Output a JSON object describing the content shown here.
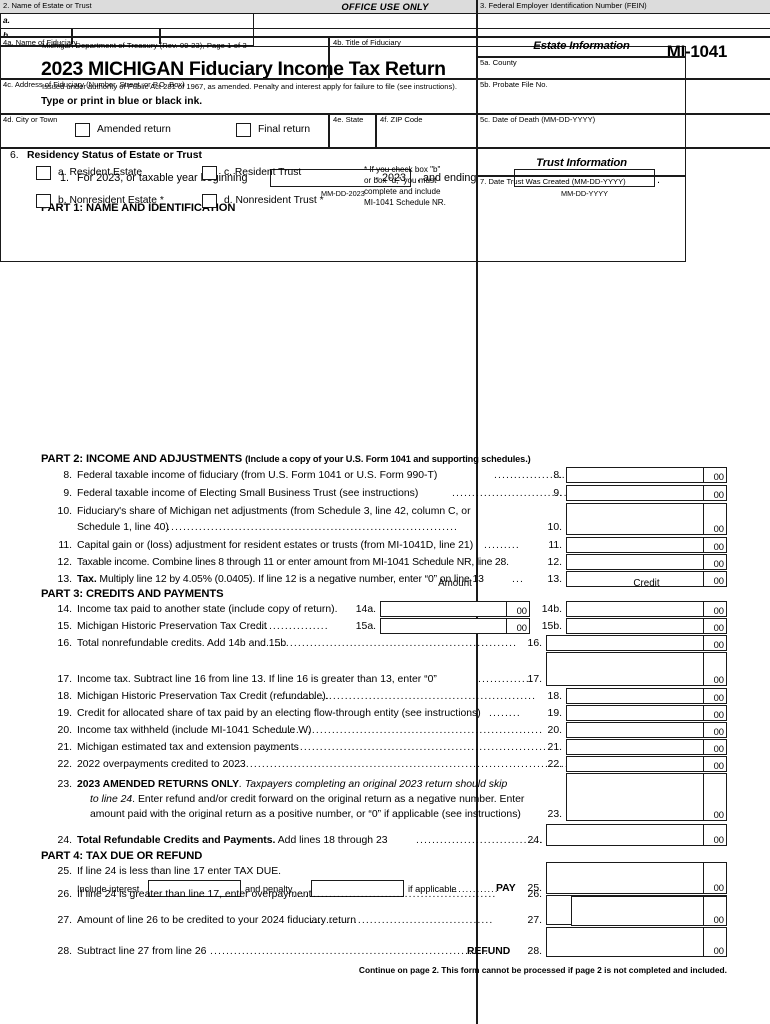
{
  "header": {
    "department": "Michigan Department of Treasury (Rev. 09-23), Page 1 of 3",
    "form_number": "MI-1041",
    "title": "2023 MICHIGAN Fiduciary Income Tax Return",
    "issued": "Issued under authority of Public Act 281 of 1967, as amended.  Penalty and interest apply for failure to file (see instructions).",
    "type_print": "Type or print in blue or black ink.",
    "amended_return": "Amended return",
    "final_return": "Final return"
  },
  "office_use": {
    "heading": "OFFICE USE ONLY",
    "row_a": "a.",
    "row_b": "b."
  },
  "line1": {
    "number": "1.",
    "text_before": "For 2023, or taxable year beginning",
    "year_suffix": "- 2023",
    "caption_begin": "MM-DD-2023",
    "text_middle": ", and ending",
    "caption_end": "MM-DD-YYYY",
    "period": "."
  },
  "part1": {
    "heading": "PART 1:  NAME AND IDENTIFICATION",
    "name_of_estate": "2. Name of Estate or Trust",
    "fein": "3. Federal Employer Identification Number (FEIN)",
    "name_of_fiduciary": "4a. Name of Fiduciary",
    "title_of_fiduciary": "4b. Title of Fiduciary",
    "estate_information": "Estate Information",
    "county": "5a. County",
    "address": "4c. Address of Fiduciary (Number, Street, or P.O. Box)",
    "probate_file": "5b. Probate File No.",
    "city": "4d. City or Town",
    "state": "4e. State",
    "zip": "4f. ZIP Code",
    "date_of_death": "5c. Date of Death (MM-DD-YYYY)",
    "residency_number": "6.",
    "residency_title": "Residency Status of Estate or Trust",
    "opt_a": "a.  Resident Estate",
    "opt_b": "b.  Nonresident Estate *",
    "opt_c": "c.  Resident Trust",
    "opt_d": "d.  Nonresident Trust *",
    "footnote_1": "* If you check box \"b\"",
    "footnote_2": "or box \"d,\" you must",
    "footnote_3": "complete and include",
    "footnote_4": "MI-1041 Schedule NR.",
    "trust_information": "Trust Information",
    "date_trust_created": "7.  Date Trust Was Created (MM-DD-YYYY)"
  },
  "part2": {
    "heading_bold": "PART 2:  INCOME AND ADJUSTMENTS",
    "heading_paren": "(Include a copy of your U.S. Form 1041 and supporting schedules.)",
    "lines": [
      {
        "num": "8.",
        "box_num": "8.",
        "text": "Federal taxable income of fiduciary (from U.S. Form 1041 or U.S. Form 990-T)",
        "cents": "00"
      },
      {
        "num": "9.",
        "box_num": "9.",
        "text": "Federal taxable income of Electing Small Business Trust (see instructions)",
        "cents": "00"
      },
      {
        "num": "10.",
        "box_num": "10.",
        "text": "Fiduciary's share of Michigan net adjustments (from Schedule 3, line 42, column C, or",
        "text2": "Schedule 1, line 40)",
        "cents": "00"
      },
      {
        "num": "11.",
        "box_num": "11.",
        "text": "Capital gain or (loss) adjustment for resident estates or trusts (from MI-1041D, line 21)",
        "cents": "00"
      },
      {
        "num": "12.",
        "box_num": "12.",
        "text": "Taxable income. Combine lines 8 through 11 or enter amount from MI-1041 Schedule NR, line 28.",
        "cents": "00"
      },
      {
        "num": "13.",
        "box_num": "13.",
        "text_bold": "Tax.",
        "text": " Multiply line 12 by 4.05% (0.0405). If line 12 is a negative number, enter “0” on line 13",
        "cents": "00"
      }
    ]
  },
  "part3": {
    "heading": "PART 3:  CREDITS AND PAYMENTS",
    "col_amount": "Amount",
    "col_credit": "Credit",
    "line14": {
      "num": "14.",
      "text": "Income tax paid to another state (include copy of return).",
      "amt_num": "14a.",
      "credit_num": "14b.",
      "cents": "00"
    },
    "line15": {
      "num": "15.",
      "text": "Michigan Historic Preservation Tax Credit",
      "amt_num": "15a.",
      "credit_num": "15b.",
      "cents": "00"
    },
    "line16": {
      "num": "16.",
      "text": "Total nonrefundable credits.  Add 14b and 15b",
      "box_num": "16.",
      "cents": "00"
    },
    "line17": {
      "num": "17.",
      "text": "Income tax. Subtract line 16 from line 13. If line 16 is greater than 13, enter “0”",
      "box_num": "17.",
      "cents": "00"
    },
    "line18": {
      "num": "18.",
      "text": "Michigan Historic Preservation Tax Credit (refundable).",
      "box_num": "18.",
      "cents": "00"
    },
    "line19": {
      "num": "19.",
      "text": "Credit for allocated share of tax paid by an electing flow-through entity (see instructions)",
      "box_num": "19.",
      "cents": "00"
    },
    "line20": {
      "num": "20.",
      "text": "Income tax withheld (include MI-1041 Schedule W)",
      "box_num": "20.",
      "cents": "00"
    },
    "line21": {
      "num": "21.",
      "text": "Michigan estimated tax and extension payments",
      "box_num": "21.",
      "cents": "00"
    },
    "line22": {
      "num": "22.",
      "text": "2022 overpayments credited to 2023",
      "box_num": "22.",
      "cents": "00"
    },
    "line23": {
      "num": "23.",
      "bold": "2023 AMENDED RETURNS ONLY",
      "italic1": ". Taxpayers completing an original 2023 return should skip",
      "italic2": "to line 24",
      "rest2": ". Enter refund and/or credit forward on the original return as a negative number. Enter",
      "line3": "amount paid with the original return as a positive number, or  “0” if applicable (see instructions)",
      "box_num": "23.",
      "cents": "00"
    },
    "line24": {
      "num": "24.",
      "bold": "Total Refundable Credits and Payments.",
      "text": " Add lines 18 through 23",
      "box_num": "24.",
      "cents": "00"
    }
  },
  "part4": {
    "heading": "PART 4:  TAX DUE OR REFUND",
    "line25": {
      "num": "25.",
      "text": "If line 24 is less than line 17 enter TAX DUE.",
      "include_interest": "Include interest",
      "and_penalty": "and penalty",
      "if_applicable": "if applicable",
      "pay": "PAY",
      "box_num": "25.",
      "cents": "00"
    },
    "line26": {
      "num": "26.",
      "text": "If line 24 is greater than line 17, enter overpayment",
      "box_num": "26.",
      "cents": "00"
    },
    "line27": {
      "num": "27.",
      "text": "Amount of line 26 to be credited to your 2024 fiduciary return",
      "box_num": "27.",
      "cents": "00"
    },
    "line28": {
      "num": "28.",
      "text": "Subtract line 27 from line 26",
      "refund": "REFUND",
      "box_num": "28.",
      "cents": "00"
    }
  },
  "footer": "Continue on page 2. This form cannot be processed if page 2 is not completed and included."
}
